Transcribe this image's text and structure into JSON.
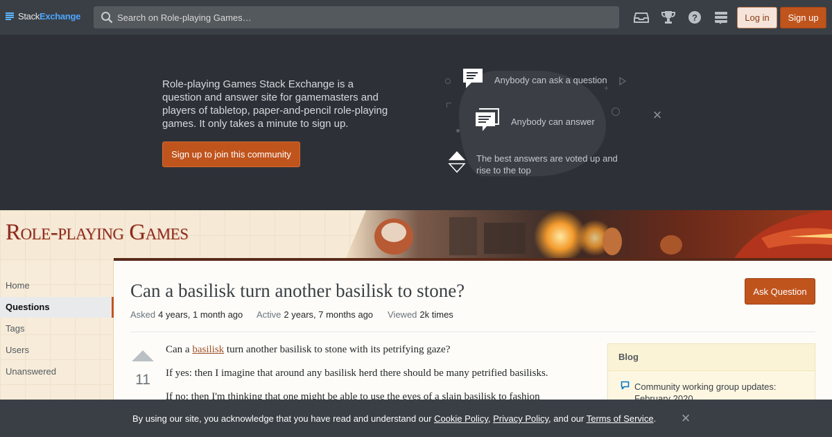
{
  "topbar": {
    "logo_part1": "Stack",
    "logo_part2": "Exchange",
    "search_placeholder": "Search on Role-playing Games…",
    "icons": [
      "inbox-icon",
      "trophy-icon",
      "help-icon",
      "site-switcher-icon"
    ],
    "login_label": "Log in",
    "signup_label": "Sign up"
  },
  "hero": {
    "text": "Role-playing Games Stack Exchange is a question and answer site for gamemasters and players of tabletop, paper-and-pencil role-playing games. It only takes a minute to sign up.",
    "cta_label": "Sign up to join this community",
    "features": [
      {
        "label": "Anybody can ask a question"
      },
      {
        "label": "Anybody can answer"
      },
      {
        "label": "The best answers are voted up and rise to the top"
      }
    ]
  },
  "site": {
    "title": "Role-playing Games"
  },
  "nav": {
    "items": [
      {
        "label": "Home"
      },
      {
        "label": "Questions"
      },
      {
        "label": "Tags"
      },
      {
        "label": "Users"
      },
      {
        "label": "Unanswered"
      }
    ]
  },
  "question": {
    "title": "Can a basilisk turn another basilisk to stone?",
    "ask_label": "Ask Question",
    "asked_key": "Asked",
    "asked_val": "4 years, 1 month ago",
    "active_key": "Active",
    "active_val": "2 years, 7 months ago",
    "viewed_key": "Viewed",
    "viewed_val": "2k times",
    "score": "11",
    "body_p1_before": "Can a ",
    "body_p1_link": "basilisk",
    "body_p1_after": " turn another basilisk to stone with its petrifying gaze?",
    "body_p2": "If yes: then I imagine that around any basilisk herd there should be many petrified basilisks.",
    "body_p3": "If no: then I'm thinking that one might be able to use the eyes of a slain basilisk to fashion"
  },
  "blog": {
    "heading": "Blog",
    "item": "Community working group updates: February 2020"
  },
  "cookie": {
    "prefix": "By using our site, you acknowledge that you have read and understand our ",
    "cookie_policy": "Cookie Policy",
    "sep1": ", ",
    "privacy_policy": "Privacy Policy",
    "sep2": ", and our ",
    "terms": "Terms of Service",
    "suffix": "."
  },
  "colors": {
    "accent": "#c0541d",
    "topbar_bg": "#393f45",
    "hero_bg": "#2d3137",
    "link": "#a0522d"
  }
}
